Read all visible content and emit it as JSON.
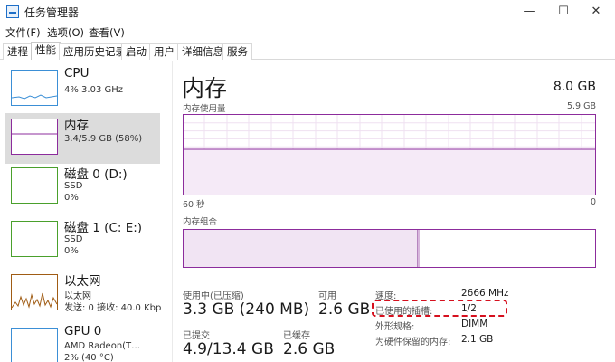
{
  "window": {
    "title": "任务管理器",
    "minimize": "—",
    "maximize": "☐",
    "close": "✕"
  },
  "menu": [
    "文件(F)",
    "选项(O)",
    "查看(V)"
  ],
  "tabs": [
    "进程",
    "性能",
    "应用历史记录",
    "启动",
    "用户",
    "详细信息",
    "服务"
  ],
  "active_tab": "性能",
  "sidebar": {
    "items": [
      {
        "name": "CPU",
        "lines": [
          "4% 3.03 GHz"
        ]
      },
      {
        "name": "内存",
        "lines": [
          "3.4/5.9 GB (58%)"
        ]
      },
      {
        "name": "磁盘 0 (D:)",
        "lines": [
          "SSD",
          "0%"
        ]
      },
      {
        "name": "磁盘 1 (C: E:)",
        "lines": [
          "SSD",
          "0%"
        ]
      },
      {
        "name": "以太网",
        "lines": [
          "以太网",
          "发送: 0 接收: 40.0 Kbp"
        ]
      },
      {
        "name": "GPU 0",
        "lines": [
          "AMD Radeon(T…",
          "2% (40 °C)"
        ]
      }
    ],
    "selected": "内存"
  },
  "main": {
    "title": "内存",
    "total": "8.0 GB",
    "usage_label": "内存使用量",
    "usage_max": "5.9 GB",
    "time_label": "60 秒",
    "time_end": "0",
    "composition_label": "内存组合",
    "composition_used_fraction": 0.58
  },
  "stats": {
    "in_use_label": "使用中(已压缩)",
    "in_use_value": "3.3 GB (240 MB)",
    "available_label": "可用",
    "available_value": "2.6 GB",
    "committed_label": "已提交",
    "committed_value": "4.9/13.4 GB",
    "cached_label": "已缓存",
    "cached_value": "2.6 GB"
  },
  "details": [
    {
      "key": "速度:",
      "value": "2666 MHz"
    },
    {
      "key": "已使用的插槽:",
      "value": "1/2"
    },
    {
      "key": "外形规格:",
      "value": "DIMM"
    },
    {
      "key": "为硬件保留的内存:",
      "value": "2.1 GB"
    }
  ],
  "colors": {
    "memory_accent": "#8c2c9c",
    "cpu_accent": "#3b8fd6",
    "disk_accent": "#4aa02c",
    "network_accent": "#a05c14",
    "highlight": "#d6101e"
  }
}
